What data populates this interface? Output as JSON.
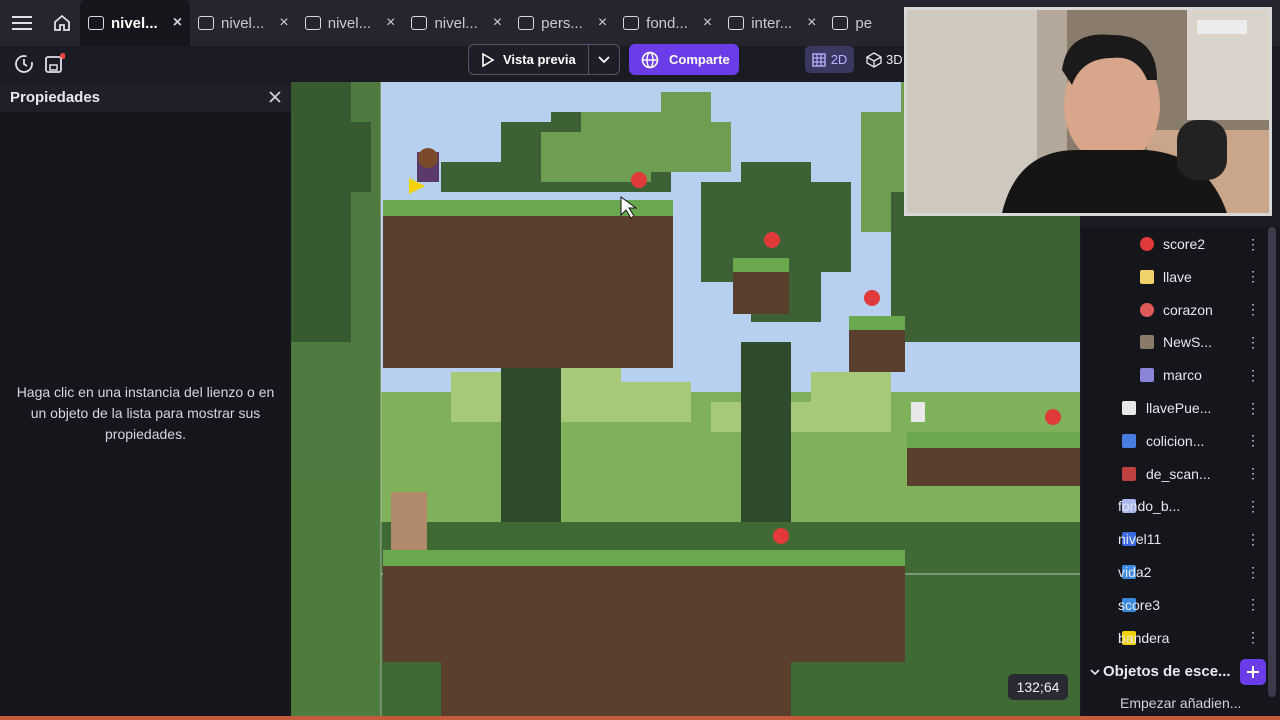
{
  "tabs": [
    {
      "label": "nivel...",
      "icon": "film-icon",
      "active": true
    },
    {
      "label": "nivel...",
      "icon": "layers-icon",
      "active": false
    },
    {
      "label": "nivel...",
      "icon": "film-icon",
      "active": false
    },
    {
      "label": "nivel...",
      "icon": "layers-icon",
      "active": false
    },
    {
      "label": "pers...",
      "icon": "object-icon",
      "active": false
    },
    {
      "label": "fond...",
      "icon": "object-icon",
      "active": false
    },
    {
      "label": "inter...",
      "icon": "object-icon",
      "active": false
    },
    {
      "label": "pe",
      "icon": "film-icon",
      "active": false
    }
  ],
  "toolbar": {
    "preview_label": "Vista previa",
    "share_label": "Comparte",
    "mode_2d": "2D",
    "mode_3d": "3D"
  },
  "properties": {
    "title": "Propiedades",
    "empty_message": "Haga clic en una instancia del lienzo o en un objeto de la lista para mostrar sus propiedades."
  },
  "objects": [
    {
      "name": "score2",
      "icon": "apple-icon",
      "color": "#e03a3a"
    },
    {
      "name": "llave",
      "icon": "key-icon",
      "color": "#f2d26b"
    },
    {
      "name": "corazon",
      "icon": "heart-icon",
      "color": "#e05a5a"
    },
    {
      "name": "NewS...",
      "icon": "barrel-icon",
      "color": "#8a7a6a"
    },
    {
      "name": "marco",
      "icon": "frame-icon",
      "color": "#8a84d8"
    },
    {
      "name": "llavePue...",
      "icon": "key-icon",
      "color": "#e8e8e8"
    },
    {
      "name": "colicion...",
      "icon": "tiles-icon",
      "color": "#4a7de0"
    },
    {
      "name": "de_scan...",
      "icon": "sprite-icon",
      "color": "#c04040"
    },
    {
      "name": "fondo_b...",
      "icon": "rectangle-icon",
      "color": "#aab8f0"
    },
    {
      "name": "nivel11",
      "icon": "tiles-icon",
      "color": "#3a6ae0"
    },
    {
      "name": "vida2",
      "icon": "text-icon",
      "color": "#3a8ae0"
    },
    {
      "name": "score3",
      "icon": "text-icon",
      "color": "#3a8ae0"
    },
    {
      "name": "bandera",
      "icon": "flag-icon",
      "color": "#f2d200"
    }
  ],
  "scene_objects": {
    "title": "Objetos de esce...",
    "start_adding": "Empezar añadien..."
  },
  "canvas": {
    "coordinates": "132;64"
  },
  "colors": {
    "accent": "#6a3de8",
    "sky": "#b8d0f0",
    "grass": "#6aa84f",
    "dirt": "#5a3e2e"
  }
}
